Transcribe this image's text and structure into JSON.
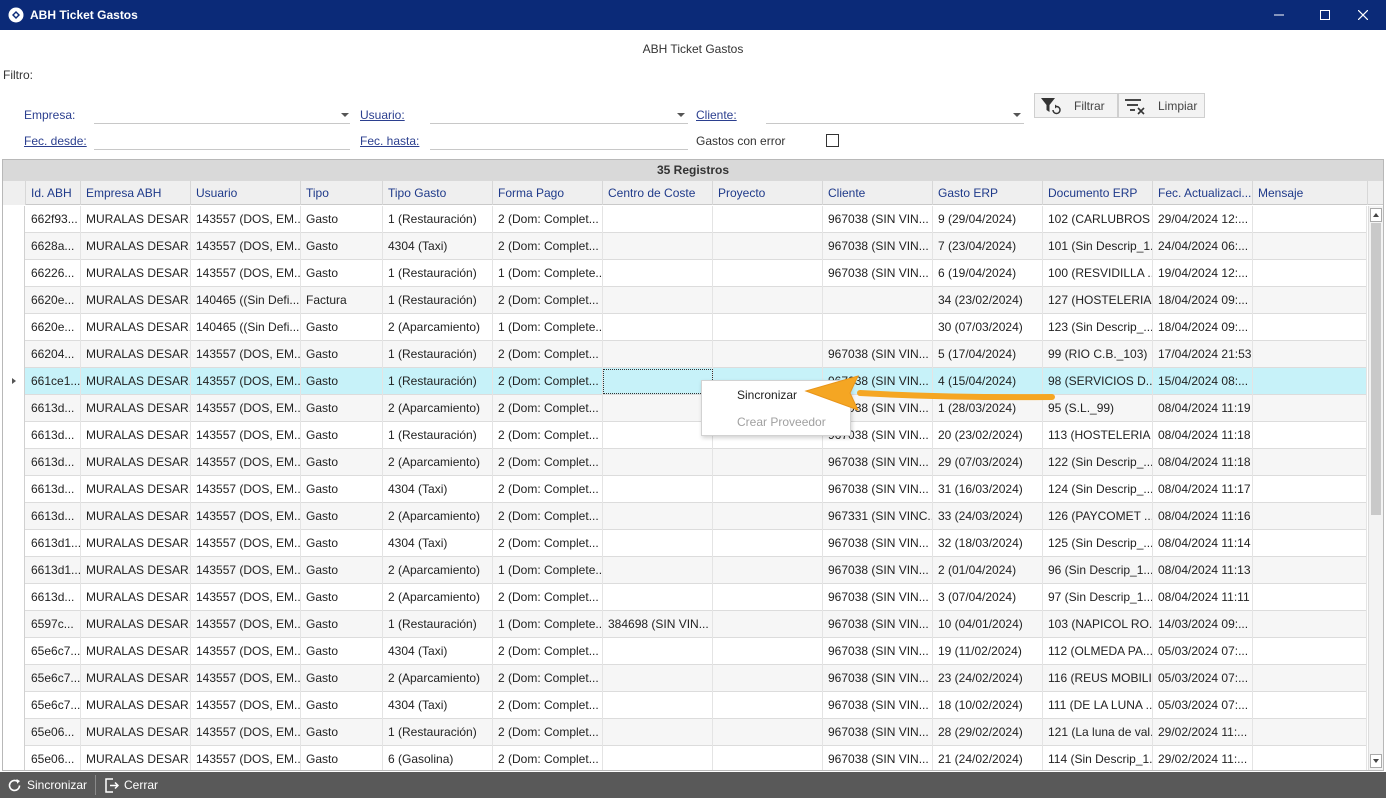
{
  "window": {
    "title": "ABH Ticket Gastos"
  },
  "heading": "ABH Ticket Gastos",
  "filter": {
    "label": "Filtro:",
    "empresa_label": "Empresa:",
    "usuario_label": "Usuario:",
    "cliente_label": "Cliente:",
    "fec_desde_label": "Fec. desde:",
    "fec_hasta_label": "Fec. hasta:",
    "gastos_error_label": "Gastos con error",
    "filtrar_label": "Filtrar",
    "limpiar_label": "Limpiar"
  },
  "grid": {
    "title": "35 Registros",
    "columns": [
      "Id. ABH",
      "Empresa ABH",
      "Usuario",
      "Tipo",
      "Tipo Gasto",
      "Forma Pago",
      "Centro de Coste",
      "Proyecto",
      "Cliente",
      "Gasto ERP",
      "Documento ERP",
      "Fec. Actualizaci...",
      "Mensaje"
    ],
    "rows": [
      [
        "662f93...",
        "MURALAS DESAR...",
        "143557 (DOS, EM...",
        "Gasto",
        "1 (Restauración)",
        "2 (Dom: Complet...",
        "",
        "",
        "967038 (SIN VIN...",
        "9 (29/04/2024)",
        "102 (CARLUBROS ...",
        "29/04/2024 12:...",
        ""
      ],
      [
        "6628a...",
        "MURALAS DESAR...",
        "143557 (DOS, EM...",
        "Gasto",
        "4304 (Taxi)",
        "2 (Dom: Complet...",
        "",
        "",
        "967038 (SIN VIN...",
        "7 (23/04/2024)",
        "101 (Sin Descrip_1...",
        "24/04/2024 06:...",
        ""
      ],
      [
        "66226...",
        "MURALAS DESAR...",
        "143557 (DOS, EM...",
        "Gasto",
        "1 (Restauración)",
        "1 (Dom: Complete...",
        "",
        "",
        "967038 (SIN VIN...",
        "6 (19/04/2024)",
        "100 (RESVIDILLA ...",
        "19/04/2024 12:...",
        ""
      ],
      [
        "6620e...",
        "MURALAS DESAR...",
        "140465 ((Sin Defi...",
        "Factura",
        "1 (Restauración)",
        "2 (Dom: Complet...",
        "",
        "",
        "",
        "34 (23/02/2024)",
        "127 (HOSTELERIA ...",
        "18/04/2024 09:...",
        ""
      ],
      [
        "6620e...",
        "MURALAS DESAR...",
        "140465 ((Sin Defi...",
        "Gasto",
        "2 (Aparcamiento)",
        "1 (Dom: Complete...",
        "",
        "",
        "",
        "30 (07/03/2024)",
        "123 (Sin Descrip_...",
        "18/04/2024 09:...",
        ""
      ],
      [
        "66204...",
        "MURALAS DESAR...",
        "143557 (DOS, EM...",
        "Gasto",
        "1 (Restauración)",
        "2 (Dom: Complet...",
        "",
        "",
        "967038 (SIN VIN...",
        "5 (17/04/2024)",
        "99 (RIO C.B._103)",
        "17/04/2024 21:53",
        ""
      ],
      [
        "661ce1...",
        "MURALAS DESAR...",
        "143557 (DOS, EM...",
        "Gasto",
        "1 (Restauración)",
        "2 (Dom: Complet...",
        "",
        "",
        "967038 (SIN VIN...",
        "4 (15/04/2024)",
        "98 (SERVICIOS D...",
        "15/04/2024 08:...",
        ""
      ],
      [
        "6613d...",
        "MURALAS DESAR...",
        "143557 (DOS, EM...",
        "Gasto",
        "2 (Aparcamiento)",
        "2 (Dom: Complet...",
        "",
        "",
        "967038 (SIN VIN...",
        "1 (28/03/2024)",
        "95 (S.L._99)",
        "08/04/2024 11:19",
        ""
      ],
      [
        "6613d...",
        "MURALAS DESAR...",
        "143557 (DOS, EM...",
        "Gasto",
        "1 (Restauración)",
        "2 (Dom: Complet...",
        "",
        "",
        "967038 (SIN VIN...",
        "20 (23/02/2024)",
        "113 (HOSTELERIA ...",
        "08/04/2024 11:18",
        ""
      ],
      [
        "6613d...",
        "MURALAS DESAR...",
        "143557 (DOS, EM...",
        "Gasto",
        "2 (Aparcamiento)",
        "2 (Dom: Complet...",
        "",
        "",
        "967038 (SIN VIN...",
        "29 (07/03/2024)",
        "122 (Sin Descrip_...",
        "08/04/2024 11:18",
        ""
      ],
      [
        "6613d...",
        "MURALAS DESAR...",
        "143557 (DOS, EM...",
        "Gasto",
        "4304 (Taxi)",
        "2 (Dom: Complet...",
        "",
        "",
        "967038 (SIN VIN...",
        "31 (16/03/2024)",
        "124 (Sin Descrip_...",
        "08/04/2024 11:17",
        ""
      ],
      [
        "6613d...",
        "MURALAS DESAR...",
        "143557 (DOS, EM...",
        "Gasto",
        "2 (Aparcamiento)",
        "2 (Dom: Complet...",
        "",
        "",
        "967331 (SIN VINC...",
        "33 (24/03/2024)",
        "126 (PAYCOMET ...",
        "08/04/2024 11:16",
        ""
      ],
      [
        "6613d1...",
        "MURALAS DESAR...",
        "143557 (DOS, EM...",
        "Gasto",
        "4304 (Taxi)",
        "2 (Dom: Complet...",
        "",
        "",
        "967038 (SIN VIN...",
        "32 (18/03/2024)",
        "125 (Sin Descrip_...",
        "08/04/2024 11:14",
        ""
      ],
      [
        "6613d1...",
        "MURALAS DESAR...",
        "143557 (DOS, EM...",
        "Gasto",
        "2 (Aparcamiento)",
        "1 (Dom: Complete...",
        "",
        "",
        "967038 (SIN VIN...",
        "2 (01/04/2024)",
        "96 (Sin Descrip_1...",
        "08/04/2024 11:13",
        ""
      ],
      [
        "6613d...",
        "MURALAS DESAR...",
        "143557 (DOS, EM...",
        "Gasto",
        "2 (Aparcamiento)",
        "2 (Dom: Complet...",
        "",
        "",
        "967038 (SIN VIN...",
        "3 (07/04/2024)",
        "97 (Sin Descrip_1...",
        "08/04/2024 11:11",
        ""
      ],
      [
        "6597c...",
        "MURALAS DESAR...",
        "143557 (DOS, EM...",
        "Gasto",
        "1 (Restauración)",
        "1 (Dom: Complete...",
        "384698 (SIN VIN...",
        "",
        "967038 (SIN VIN...",
        "10 (04/01/2024)",
        "103 (NAPICOL RO...",
        "14/03/2024 09:...",
        ""
      ],
      [
        "65e6c7...",
        "MURALAS DESAR...",
        "143557 (DOS, EM...",
        "Gasto",
        "4304 (Taxi)",
        "2 (Dom: Complet...",
        "",
        "",
        "967038 (SIN VIN...",
        "19 (11/02/2024)",
        "112 (OLMEDA PA...",
        "05/03/2024 07:...",
        ""
      ],
      [
        "65e6c7...",
        "MURALAS DESAR...",
        "143557 (DOS, EM...",
        "Gasto",
        "2 (Aparcamiento)",
        "2 (Dom: Complet...",
        "",
        "",
        "967038 (SIN VIN...",
        "23 (24/02/2024)",
        "116 (REUS MOBILI...",
        "05/03/2024 07:...",
        ""
      ],
      [
        "65e6c7...",
        "MURALAS DESAR...",
        "143557 (DOS, EM...",
        "Gasto",
        "4304 (Taxi)",
        "2 (Dom: Complet...",
        "",
        "",
        "967038 (SIN VIN...",
        "18 (10/02/2024)",
        "111 (DE LA LUNA ...",
        "05/03/2024 07:...",
        ""
      ],
      [
        "65e06...",
        "MURALAS DESAR...",
        "143557 (DOS, EM...",
        "Gasto",
        "1 (Restauración)",
        "2 (Dom: Complet...",
        "",
        "",
        "967038 (SIN VIN...",
        "28 (29/02/2024)",
        "121 (La luna de val...",
        "29/02/2024 11:...",
        ""
      ],
      [
        "65e06...",
        "MURALAS DESAR...",
        "143557 (DOS, EM...",
        "Gasto",
        "6 (Gasolina)",
        "2 (Dom: Complet...",
        "",
        "",
        "967038 (SIN VIN...",
        "21 (24/02/2024)",
        "114 (Sin Descrip_1...",
        "29/02/2024 11:...",
        ""
      ]
    ],
    "selected_row": 6
  },
  "context_menu": {
    "items": [
      "Sincronizar",
      "Crear Proveedor"
    ]
  },
  "footer": {
    "sincronizar_label": "Sincronizar",
    "cerrar_label": "Cerrar"
  },
  "colors": {
    "titlebar": "#0b2a78",
    "selected_row": "#c7f2f9",
    "annotation_arrow": "#f5a623",
    "footer": "#595959"
  }
}
